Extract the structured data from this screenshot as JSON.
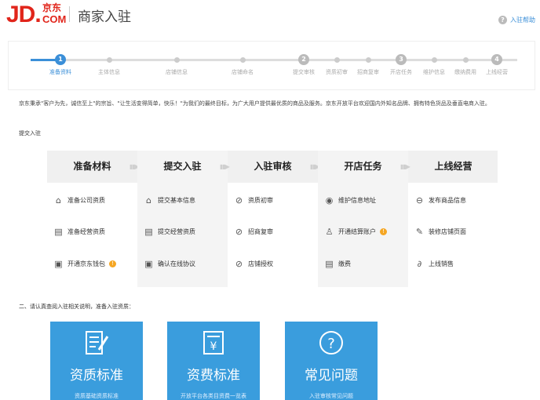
{
  "header": {
    "logo_jd": "JD.",
    "logo_cn": "京东",
    "logo_com": "COM",
    "title": "商家入驻",
    "help_label": "入驻帮助"
  },
  "steps": [
    {
      "label": "准备资料",
      "number": "1",
      "active": true
    },
    {
      "label": "主体信息"
    },
    {
      "label": "店铺信息"
    },
    {
      "label": "店铺命名"
    },
    {
      "label": "提交审核",
      "number": "2"
    },
    {
      "label": "资质初审"
    },
    {
      "label": "招商复审"
    },
    {
      "label": "开店任务",
      "number": "3"
    },
    {
      "label": "维护信息"
    },
    {
      "label": "缴纳费用"
    },
    {
      "label": "上线经营",
      "number": "4"
    }
  ],
  "intro": "京东秉承\"客户为先，诚信至上\"的宗旨、\"让生活变得简单，快乐！\"为我们的最终目标，为广大用户提供最优质的商品及服务。京东开放平台欢迎国内外知名品牌、拥有特色货品及垂直电商入驻。",
  "submit_label": "提交入驻",
  "process": [
    {
      "title": "准备材料",
      "items": [
        {
          "icon": "house-icon",
          "label": "准备公司资质"
        },
        {
          "icon": "calendar-icon",
          "label": "准备经营资质"
        },
        {
          "icon": "wallet-icon",
          "label": "开通京东钱包",
          "warn": "!"
        }
      ]
    },
    {
      "title": "提交入驻",
      "items": [
        {
          "icon": "house-icon",
          "label": "提交基本信息"
        },
        {
          "icon": "calendar-icon",
          "label": "提交经营资质"
        },
        {
          "icon": "wallet-icon",
          "label": "确认在线协议"
        }
      ]
    },
    {
      "title": "入驻审核",
      "items": [
        {
          "icon": "check-circle-icon",
          "label": "资质初审"
        },
        {
          "icon": "check-circle-icon",
          "label": "招商复审"
        },
        {
          "icon": "check-circle-icon",
          "label": "店铺授权"
        }
      ]
    },
    {
      "title": "开店任务",
      "items": [
        {
          "icon": "location-pin-icon",
          "label": "维护信息地址"
        },
        {
          "icon": "user-icon",
          "label": "开通结算账户",
          "warn": "!"
        },
        {
          "icon": "calendar-icon",
          "label": "缴费"
        }
      ]
    },
    {
      "title": "上线经营",
      "items": [
        {
          "icon": "bag-icon",
          "label": "发布商品信息"
        },
        {
          "icon": "brush-icon",
          "label": "装修店铺页面"
        },
        {
          "icon": "link-icon",
          "label": "上线销售"
        }
      ]
    }
  ],
  "section2_title": "二、请认真查阅入驻相关说明，准备入驻资质：",
  "cards": [
    {
      "title": "资质标准",
      "sub": "资质基础资质标准"
    },
    {
      "title": "资费标准",
      "sub": "开放平台各类目资费一览表"
    },
    {
      "title": "常见问题",
      "sub": "入驻审核常见问题"
    }
  ],
  "colors": {
    "brand_red": "#e1251b",
    "accent_blue": "#3b8fd8",
    "card_blue": "#3a9ddd",
    "warn_orange": "#f5a623"
  }
}
